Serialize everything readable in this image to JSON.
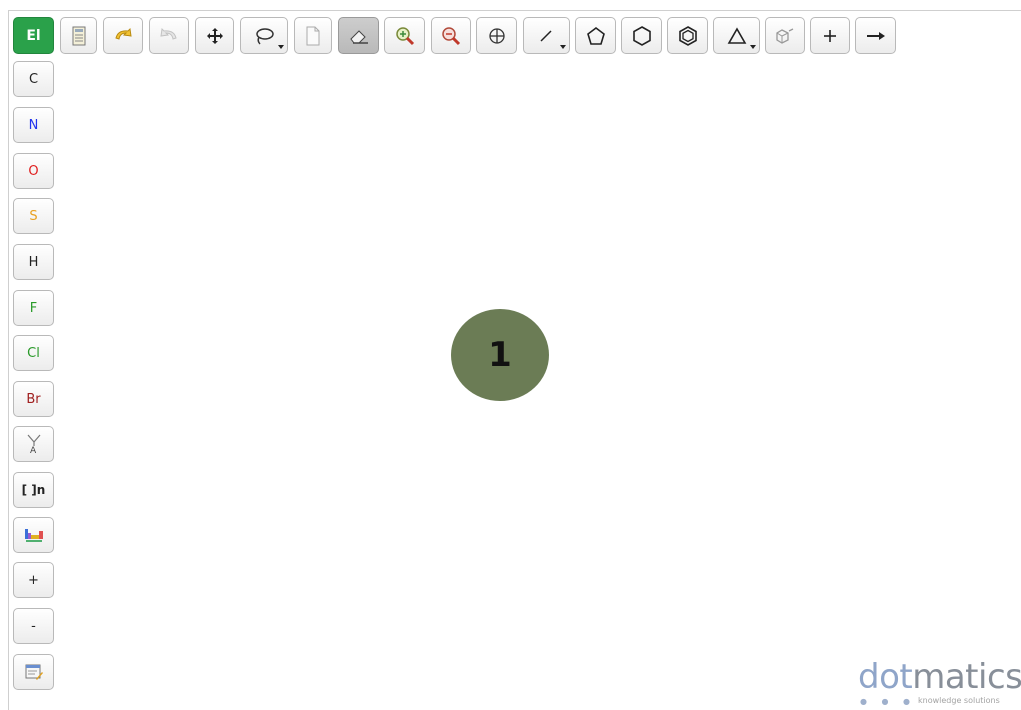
{
  "toolbar": {
    "element_label": "El",
    "buttons": [
      {
        "name": "template-icon"
      },
      {
        "name": "undo-icon"
      },
      {
        "name": "redo-icon"
      },
      {
        "name": "move-icon"
      },
      {
        "name": "lasso-icon"
      },
      {
        "name": "new-document-icon"
      },
      {
        "name": "eraser-icon"
      },
      {
        "name": "zoom-in-icon"
      },
      {
        "name": "zoom-out-icon"
      },
      {
        "name": "grid-icon"
      },
      {
        "name": "bond-icon"
      },
      {
        "name": "pentagon-icon"
      },
      {
        "name": "hexagon-icon"
      },
      {
        "name": "benzene-icon"
      },
      {
        "name": "triangle-icon"
      },
      {
        "name": "3d-view-icon"
      },
      {
        "name": "plus-icon"
      },
      {
        "name": "arrow-right-icon"
      }
    ]
  },
  "sidebar": {
    "atoms": [
      {
        "label": "C",
        "color": "#222222"
      },
      {
        "label": "N",
        "color": "#2233ee"
      },
      {
        "label": "O",
        "color": "#e02020"
      },
      {
        "label": "S",
        "color": "#e8a020"
      },
      {
        "label": "H",
        "color": "#222222"
      },
      {
        "label": "F",
        "color": "#2a9a2a"
      },
      {
        "label": "Cl",
        "color": "#2a9a2a"
      },
      {
        "label": "Br",
        "color": "#a02020"
      }
    ],
    "tools": [
      {
        "name": "atom-query-icon"
      },
      {
        "name": "bracket-icon",
        "label": "[ ]n"
      },
      {
        "name": "periodic-table-icon"
      },
      {
        "name": "charge-plus-icon",
        "label": "+"
      },
      {
        "name": "charge-minus-icon",
        "label": "-"
      },
      {
        "name": "notes-icon"
      }
    ]
  },
  "canvas": {
    "marker_label": "1"
  },
  "logo": {
    "part1": "dot",
    "part2": "matics",
    "tagline": "knowledge solutions",
    "dot_color": "#8fa5c9",
    "matics_color": "#888f99"
  }
}
